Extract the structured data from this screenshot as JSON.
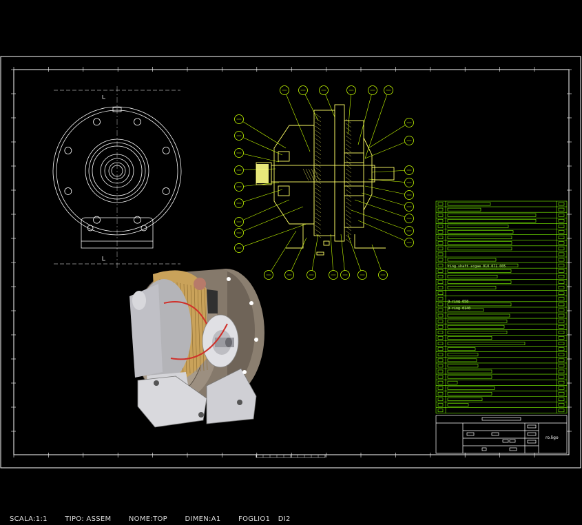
{
  "status_bar": {
    "scala": "SCALA:1:1",
    "tipo": "TIPO: ASSEM",
    "nome": "NOME:TOP",
    "dimen": "DIMEN:A1",
    "foglio": "FOGLIO1",
    "di": "DI2"
  },
  "parts_list": {
    "row_labels": [
      "ring shaft scgae 010 071 005",
      "O-ring 058",
      "O ring 0140"
    ]
  },
  "title_block": {
    "logo_text": "ro.ligo"
  },
  "colors": {
    "frame": "#ffffff",
    "balloon": "#c8ff00",
    "table": "#7fff00",
    "section": "#ffff66"
  }
}
